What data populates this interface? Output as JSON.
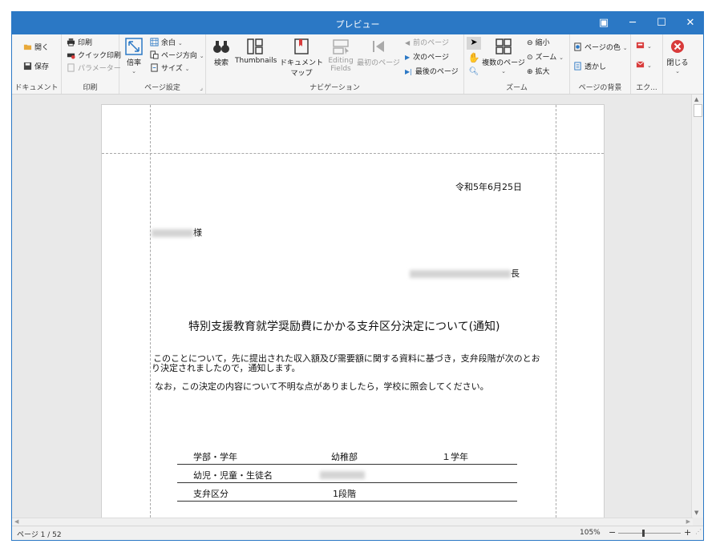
{
  "window": {
    "title": "プレビュー",
    "controls": {
      "restore": "▣",
      "minimize": "─",
      "maximize": "☐",
      "close": "✕"
    }
  },
  "ribbon": {
    "groups": {
      "document": {
        "label": "ドキュメント",
        "open": "開く",
        "save": "保存"
      },
      "print": {
        "label": "印刷",
        "print": "印刷",
        "quick_print": "クイック印刷",
        "parameters": "パラメーター"
      },
      "page_setup": {
        "label": "ページ設定",
        "scale": "倍率",
        "margins": "余白",
        "orientation": "ページ方向",
        "size": "サイズ"
      },
      "navigation": {
        "label": "ナビゲーション",
        "search": "検索",
        "thumbnails": "Thumbnails",
        "document_map": "ドキュメントマップ",
        "editing_fields_1": "Editing",
        "editing_fields_2": "Fields",
        "first_page": "最初のページ",
        "prev_page": "前のページ",
        "next_page": "次のページ",
        "last_page": "最後のページ"
      },
      "zoom": {
        "label": "ズーム",
        "multi_page": "複数のページ",
        "zoom_out": "縮小",
        "zoom": "ズーム",
        "zoom_in": "拡大"
      },
      "background": {
        "label": "ページの背景",
        "page_color": "ページの色",
        "watermark": "透かし"
      },
      "export": {
        "label": "エク..."
      },
      "close": {
        "label": "閉じる"
      }
    }
  },
  "document": {
    "date": "令和5年6月25日",
    "recipient_suffix": "様",
    "sender_suffix": "長",
    "title": "特別支援教育就学奨励費にかかる支弁区分決定について(通知)",
    "body_1a": " このことについて，先に提出された収入額及び需要額に関する資料に基づき，支弁段階が次のとお",
    "body_1b": "り決定されましたので，通知します。",
    "body_2": " なお，この決定の内容について不明な点がありましたら，学校に照会してください。",
    "table": {
      "row1_label": "学部・学年",
      "row1_value1": "幼稚部",
      "row1_value2": "１学年",
      "row2_label": "幼児・児童・生徒名",
      "row3_label": "支弁区分",
      "row3_value": "1段階"
    }
  },
  "status": {
    "page_indicator": "ページ 1 / 52",
    "zoom_level": "105%",
    "zoom_value": 0.4,
    "minus": "−",
    "plus": "+"
  },
  "icons": {
    "accent": "#2b78c5",
    "red": "#d83b3b"
  }
}
